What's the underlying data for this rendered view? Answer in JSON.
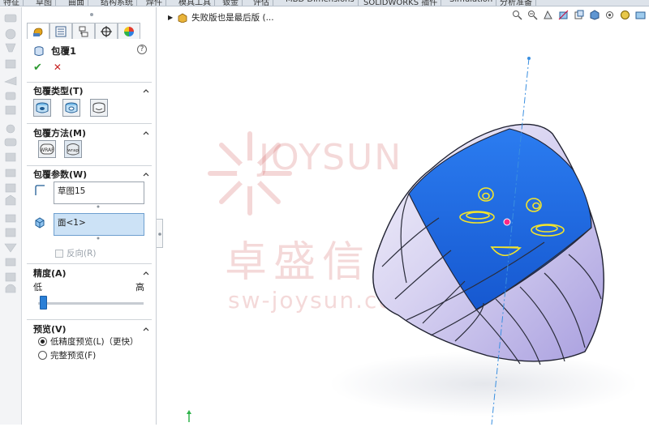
{
  "ribbon_tabs": [
    "特征",
    "草图",
    "曲面",
    "结构系统",
    "焊件",
    "模具工具",
    "钣金",
    "评估",
    "MBD Dimensions",
    "SOLIDWORKS 插件",
    "Simulation",
    "分析准备"
  ],
  "property_manager": {
    "feature_title": "包覆1",
    "help_icon": "?",
    "groups": {
      "wrap_type": {
        "title": "包覆类型(T)"
      },
      "wrap_method": {
        "title": "包覆方法(M)"
      },
      "wrap_params": {
        "title": "包覆参数(W)",
        "sketch_value": "草图15",
        "face_value": "面<1>",
        "reverse_label": "反向(R)"
      },
      "accuracy": {
        "title": "精度(A)",
        "low_label": "低",
        "high_label": "高",
        "level": 0.02
      },
      "preview": {
        "title": "预览(V)",
        "option_low": "低精度预览(L)（更快）",
        "option_full": "完整预览(F)",
        "selected": "low"
      }
    }
  },
  "viewport": {
    "tree_root_label": "失败版也是最后版 (...",
    "watermark": {
      "brand_latin": "JOYSUN",
      "brand_cn": "卓盛信息",
      "url": "sw-joysun.com.cn"
    }
  },
  "colors": {
    "accent_blue": "#2a7fd6",
    "face_blue": "#1f6fe6",
    "body_lavender": "#bdb6ea",
    "ok_green": "#2e9a32",
    "cancel_red": "#c82222"
  }
}
